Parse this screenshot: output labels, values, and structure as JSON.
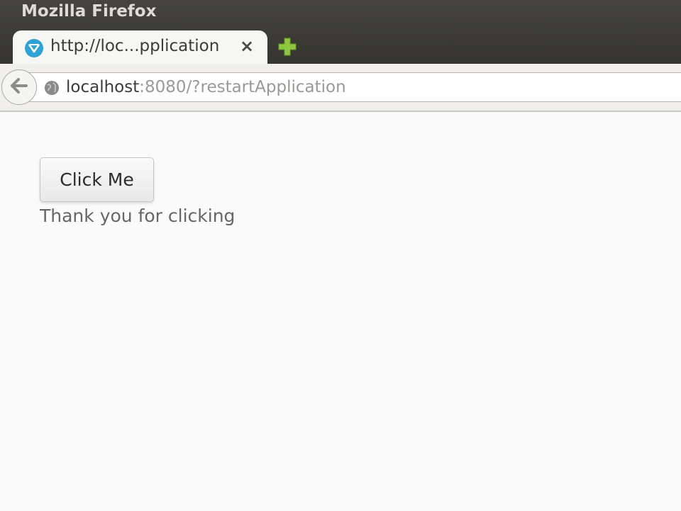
{
  "window": {
    "title": "Mozilla Firefox"
  },
  "tab": {
    "title": "http://loc...pplication",
    "close_glyph": "×",
    "favicon": "vaadin-logo-icon"
  },
  "new_tab": {
    "icon": "plus-icon",
    "color": "#8ec63f"
  },
  "navbar": {
    "back_icon": "back-arrow-icon",
    "site_icon": "globe-icon",
    "url_host": "localhost",
    "url_rest": ":8080/?restartApplication"
  },
  "main": {
    "button_label": "Click Me",
    "message": "Thank you for clicking"
  }
}
